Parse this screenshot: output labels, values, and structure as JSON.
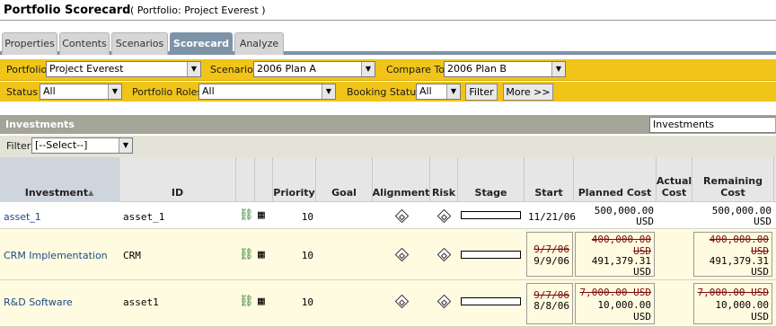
{
  "header": {
    "title": "Portfolio Scorecard",
    "subtitle": "( Portfolio: Project Everest )"
  },
  "tabs": [
    {
      "label": "Properties"
    },
    {
      "label": "Contents"
    },
    {
      "label": "Scenarios"
    },
    {
      "label": "Scorecard",
      "active": true
    },
    {
      "label": "Analyze"
    }
  ],
  "filters1": {
    "portfolio_label": "Portfolio",
    "portfolio_value": "Project Everest",
    "scenario_label": "Scenario",
    "scenario_value": "2006 Plan A",
    "compare_label": "Compare To",
    "compare_value": "2006 Plan B"
  },
  "filters2": {
    "status_label": "Status",
    "status_value": "All",
    "roles_label": "Portfolio Roles",
    "roles_value": "All",
    "booking_label": "Booking Status",
    "booking_value": "All",
    "filter_button": "Filter",
    "more_button": "More >>"
  },
  "investments": {
    "title": "Investments",
    "view_value": "Investments",
    "filter_label": "Filter",
    "filter_value": "[--Select--]"
  },
  "columns": {
    "investment": "Investment",
    "id": "ID",
    "priority": "Priority",
    "goal": "Goal",
    "alignment": "Alignment",
    "risk": "Risk",
    "stage": "Stage",
    "start": "Start",
    "planned_cost": "Planned Cost",
    "actual_cost": "Actual Cost",
    "remaining_cost": "Remaining Cost"
  },
  "rows": [
    {
      "investment": "asset_1",
      "id": "asset_1",
      "priority": "10",
      "start_new": "11/21/06",
      "planned_new": "500,000.00",
      "planned_unit": "USD",
      "remaining_new": "500,000.00",
      "remaining_unit": "USD"
    },
    {
      "investment": "CRM Implementation",
      "id": "CRM",
      "priority": "10",
      "start_old": "9/7/06",
      "start_new": "9/9/06",
      "planned_old": "400,000.00 USD",
      "planned_new": "491,379.31",
      "planned_unit": "USD",
      "remaining_old": "400,000.00 USD",
      "remaining_new": "491,379.31",
      "remaining_unit": "USD"
    },
    {
      "investment": "R&D Software",
      "id": "asset1",
      "priority": "10",
      "start_old": "9/7/06",
      "start_new": "8/8/06",
      "planned_old": "7,000.00 USD",
      "planned_new": "10,000.00",
      "planned_unit": "USD",
      "remaining_old": "7,000.00 USD",
      "remaining_new": "10,000.00",
      "remaining_unit": "USD"
    }
  ],
  "colors": {
    "accent_yellow": "#f0c419",
    "tab_active": "#7d93a8",
    "section_bar": "#a4a498",
    "strike_red": "#7a0a0a"
  }
}
